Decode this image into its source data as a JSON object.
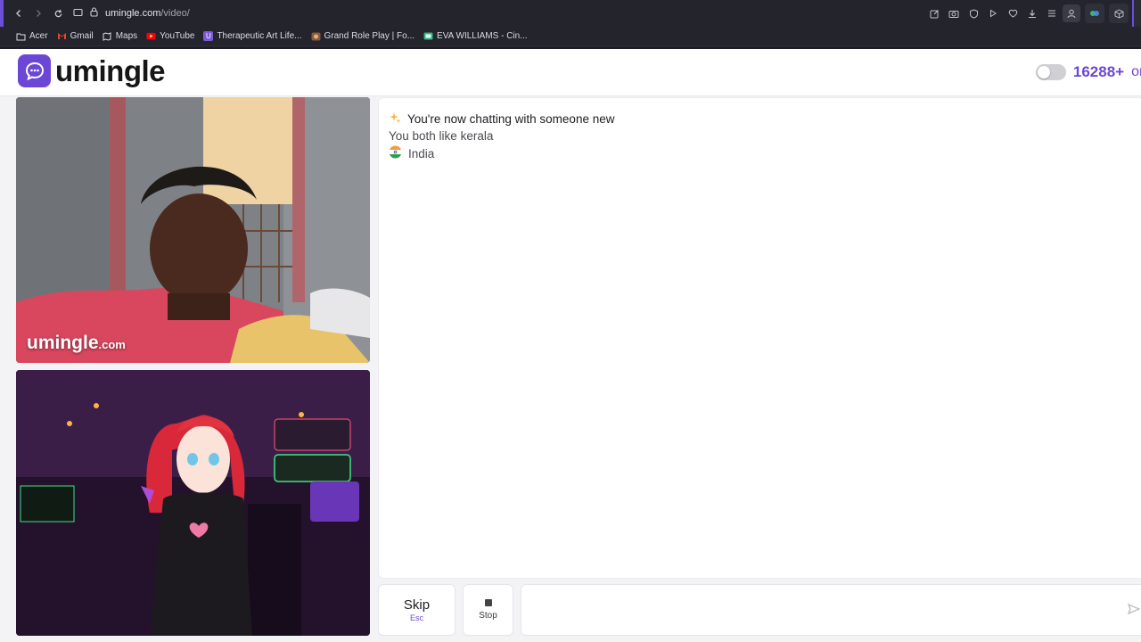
{
  "browser": {
    "url_domain": "umingle.com",
    "url_path": "/video/",
    "bookmarks": [
      {
        "label": "Acer",
        "icon": "folder-icon"
      },
      {
        "label": "Gmail",
        "icon": "gmail-icon"
      },
      {
        "label": "Maps",
        "icon": "maps-icon"
      },
      {
        "label": "YouTube",
        "icon": "youtube-icon"
      },
      {
        "label": "Therapeutic Art Life...",
        "icon": "site-icon"
      },
      {
        "label": "Grand Role Play | Fo...",
        "icon": "site-icon"
      },
      {
        "label": "EVA WILLIAMS - Cin...",
        "icon": "site-icon"
      }
    ]
  },
  "header": {
    "logo_text": "umingle",
    "online_count": "16288+",
    "online_label": "onli"
  },
  "videos": {
    "watermark_name": "umingle",
    "watermark_domain": ".com"
  },
  "chat": {
    "lines": [
      {
        "icon": "sparkle-icon",
        "text": "You're now chatting with someone new"
      },
      {
        "text": "You both like kerala"
      },
      {
        "icon": "india-flag-icon",
        "text": "India"
      }
    ]
  },
  "controls": {
    "skip_label": "Skip",
    "skip_shortcut": "Esc",
    "stop_label": "Stop"
  },
  "colors": {
    "brand": "#6c47d6",
    "chrome_bg": "#23242c",
    "page_bg": "#f3f3f5"
  }
}
